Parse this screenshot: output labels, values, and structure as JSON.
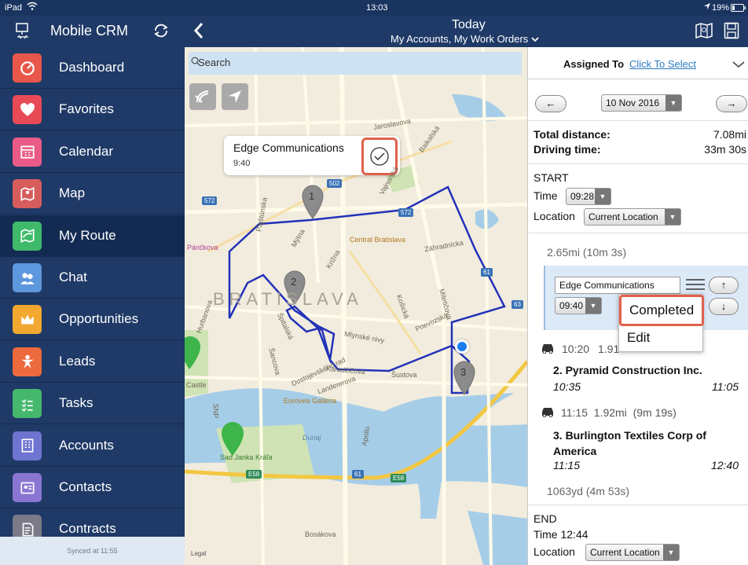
{
  "statusbar": {
    "device": "iPad",
    "time": "13:03",
    "battery": "19%"
  },
  "sidebar": {
    "title": "Mobile CRM",
    "items": [
      {
        "label": "Dashboard",
        "icon": "dashboard-icon",
        "color": "#e9574a"
      },
      {
        "label": "Favorites",
        "icon": "heart-icon",
        "color": "#e84a55"
      },
      {
        "label": "Calendar",
        "icon": "calendar-icon",
        "color": "#e95b86"
      },
      {
        "label": "Map",
        "icon": "map-icon",
        "color": "#d65d5c"
      },
      {
        "label": "My Route",
        "icon": "route-icon",
        "color": "#3fba6a"
      },
      {
        "label": "Chat",
        "icon": "chat-icon",
        "color": "#5d97dd"
      },
      {
        "label": "Opportunities",
        "icon": "crown-icon",
        "color": "#f2a830"
      },
      {
        "label": "Leads",
        "icon": "leads-icon",
        "color": "#ec6a3d"
      },
      {
        "label": "Tasks",
        "icon": "tasks-icon",
        "color": "#45b86d"
      },
      {
        "label": "Accounts",
        "icon": "accounts-icon",
        "color": "#6e74cf"
      },
      {
        "label": "Contacts",
        "icon": "contacts-icon",
        "color": "#8a76d2"
      },
      {
        "label": "Contracts",
        "icon": "contracts-icon",
        "color": "#7a7a88"
      }
    ],
    "active_index": 4,
    "footer": "Synced at 11:55"
  },
  "topbar": {
    "title": "Today",
    "subtitle": "My Accounts, My Work Orders"
  },
  "map": {
    "search_placeholder": "Search",
    "callout": {
      "title": "Edge Communications",
      "time": "9:40"
    },
    "pins": [
      "1",
      "2",
      "3"
    ],
    "city_label": "BRATISLAVA",
    "road_badges": [
      "502",
      "572",
      "572",
      "61",
      "63",
      "61",
      "E58",
      "E58"
    ],
    "labels": [
      "Central Bratislava",
      "Eurovea Galleria",
      "Sad Janka Kráľa",
      "Dunaj",
      "Mýtna",
      "Križna",
      "Záhradnícka",
      "Bosákova",
      "Šancova",
      "Legal",
      "Castle",
      "Apollo",
      "Košická",
      "Mlynské nivy",
      "Prievozská",
      "Dostojevského rad",
      "Karadžičova",
      "Jaroslavova",
      "Baikalská",
      "Špitalská",
      "Vajnorská",
      "Miletičova",
      "Šustova",
      "Pajštúnska",
      "Landererova",
      "SNP",
      "Hurbanova",
      "Páričkova"
    ]
  },
  "right_panel": {
    "assigned_label": "Assigned To",
    "assigned_link": "Click To Select",
    "date": "10 Nov 2016",
    "total_distance_label": "Total distance:",
    "total_distance": "7.08mi",
    "driving_time_label": "Driving time:",
    "driving_time": "33m 30s",
    "start_label": "START",
    "time_label": "Time",
    "start_time": "09:28",
    "location_label": "Location",
    "location_value": "Current Location",
    "leg1": "2.65mi  (10m 3s)",
    "stop1_name": "Edge Communications",
    "stop1_time": "09:40",
    "menu": {
      "completed": "Completed",
      "edit": "Edit"
    },
    "leg2_time": "10:20",
    "leg2_dist": "1.91",
    "stop2_name": "2. Pyramid Construction Inc.",
    "stop2_start": "10:35",
    "stop2_end": "11:05",
    "leg3": "11:15  1.92mi  (9m 19s)",
    "stop3_name": "3. Burlington Textiles Corp of America",
    "stop3_start": "11:15",
    "stop3_end": "12:40",
    "leg4": "1063yd  (4m 53s)",
    "end_label": "END",
    "end_time": "Time 12:44",
    "end_location_value": "Current Location"
  }
}
